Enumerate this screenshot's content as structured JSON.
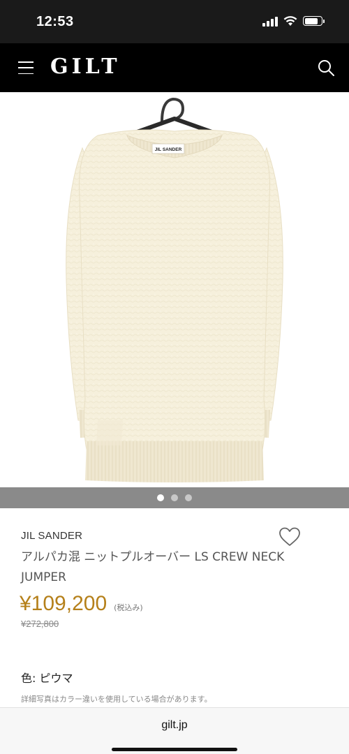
{
  "status_bar": {
    "time": "12:53",
    "signal_level": 1.0,
    "battery_level": 0.8
  },
  "header": {
    "logo": "GILT",
    "menu_icon": "hamburger-menu-icon",
    "search_icon": "search-icon"
  },
  "product": {
    "image": "cream-fuzzy-sweater-on-hanger",
    "tag_text": "JIL SANDER",
    "carousel": {
      "total": 3,
      "active_index": 0
    },
    "brand": "JIL SANDER",
    "title": "アルパカ混 ニットプルオーバー LS CREW NECK JUMPER",
    "price": "¥109,200",
    "tax_note": "(税込み)",
    "original_price": "¥272,800",
    "color_label": "色: ピウマ",
    "note": "詳細写真はカラー違いを使用している場合があります。",
    "favorite_icon": "heart-outline-icon"
  },
  "url_bar": {
    "url": "gilt.jp"
  },
  "colors": {
    "status_bar_bg": "#1a1a1a",
    "header_bg": "#000000",
    "price": "#b5801a",
    "carousel_bar_bg": "#8a8a8a",
    "sweater": "#f6f0dc"
  }
}
